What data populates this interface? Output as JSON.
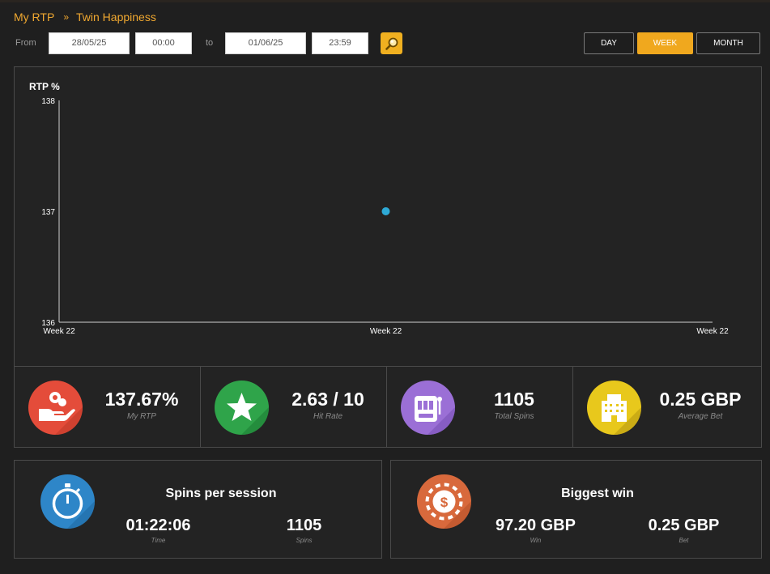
{
  "breadcrumb": {
    "root": "My RTP",
    "separator": "»",
    "current": "Twin Happiness"
  },
  "filters": {
    "from_label": "From",
    "from_date": "28/05/25",
    "from_time": "00:00",
    "to_label": "to",
    "to_date": "01/06/25",
    "to_time": "23:59",
    "search_icon": "search-icon"
  },
  "periods": [
    {
      "label": "DAY",
      "active": false
    },
    {
      "label": "WEEK",
      "active": true
    },
    {
      "label": "MONTH",
      "active": false
    }
  ],
  "colors": {
    "accent": "#f0a81e",
    "point": "#2eaad6"
  },
  "chart_data": {
    "type": "scatter",
    "ylabel": "RTP %",
    "ylim": [
      136,
      138
    ],
    "yticks": [
      "138",
      "137",
      "136"
    ],
    "xticks": [
      "Week 22",
      "Week 22",
      "Week 22"
    ],
    "points": [
      {
        "x": "Week 22",
        "y": 137
      }
    ]
  },
  "stats": [
    {
      "value": "137.67%",
      "label": "My RTP",
      "icon": "hand-coin-icon",
      "color": "#e44c3a"
    },
    {
      "value": "2.63 / 10",
      "label": "Hit Rate",
      "icon": "star-icon",
      "color": "#2fa44a"
    },
    {
      "value": "1105",
      "label": "Total Spins",
      "icon": "slot-machine-icon",
      "color": "#9b6fd6"
    },
    {
      "value": "0.25 GBP",
      "label": "Average Bet",
      "icon": "casino-building-icon",
      "color": "#e8c81c"
    }
  ],
  "sessions": {
    "title": "Spins per session",
    "icon": "stopwatch-icon",
    "time_value": "01:22:06",
    "time_label": "Time",
    "spins_value": "1105",
    "spins_label": "Spins"
  },
  "biggest_win": {
    "title": "Biggest win",
    "icon": "casino-chip-icon",
    "win_value": "97.20 GBP",
    "win_label": "Win",
    "bet_value": "0.25 GBP",
    "bet_label": "Bet"
  }
}
